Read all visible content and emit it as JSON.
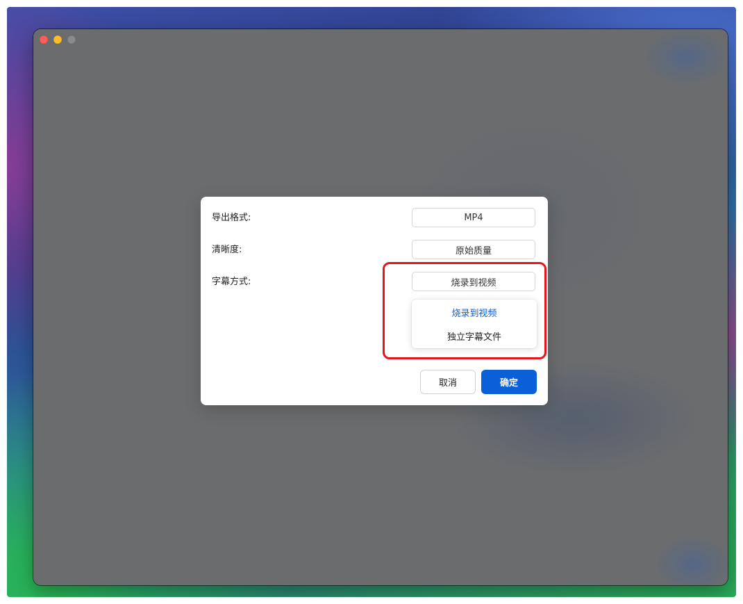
{
  "dialog": {
    "fields": [
      {
        "label": "导出格式:",
        "value": "MP4"
      },
      {
        "label": "清晰度:",
        "value": "原始质量"
      },
      {
        "label": "字幕方式:",
        "value": "烧录到视频"
      }
    ],
    "subtitle_dropdown": {
      "options": [
        "烧录到视频",
        "独立字幕文件"
      ],
      "selected": "烧录到视频"
    },
    "buttons": {
      "cancel": "取消",
      "confirm": "确定"
    }
  },
  "colors": {
    "accent": "#0a60d8",
    "selected_option": "#0a5bd3",
    "highlight": "#e8141c",
    "window_close": "#ff5f57",
    "window_minimize": "#febc2e",
    "window_maximize": "#8a8b8d"
  }
}
